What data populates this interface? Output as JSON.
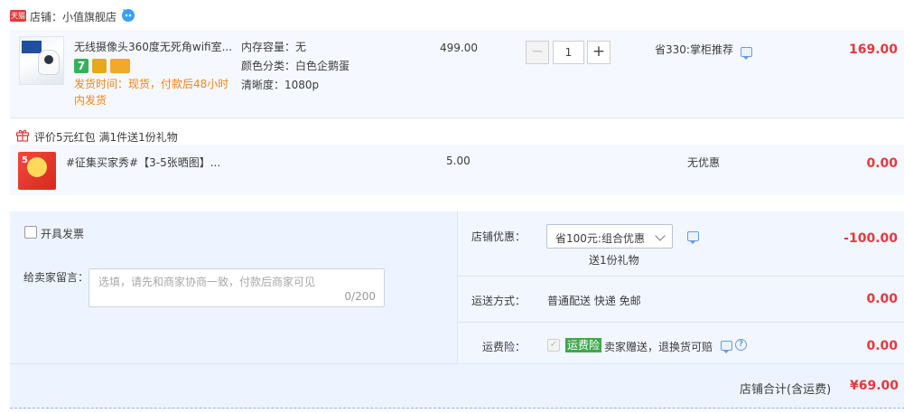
{
  "shop": {
    "badge": "天猫",
    "label": "店铺：小值旗舰店"
  },
  "items": [
    {
      "title": "无线摄像头360度无死角wifi室...",
      "delivery": "发货时间：现货，付款后48小时内发货",
      "service_badge": "7",
      "attrs": [
        "内存容量：无",
        "颜色分类：白色企鹅蛋",
        "清晰度：1080p"
      ],
      "price": "499.00",
      "quantity": "1",
      "promo": "省330:掌柜推荐",
      "amount": "169.00"
    },
    {
      "title": "#征集买家秀#【3-5张晒图】...",
      "thumb_text": "5",
      "price": "5.00",
      "promo": "无优惠",
      "amount": "0.00"
    }
  ],
  "gift_line": "评价5元红包   满1件送1份礼物",
  "qty_controls": {
    "minus": "−",
    "plus": "+"
  },
  "invoice": {
    "label": "开具发票"
  },
  "message": {
    "label": "给卖家留言：",
    "placeholder": "选填，请先和商家协商一致，付款后商家可见",
    "counter": "0/200"
  },
  "shop_discount": {
    "label": "店铺优惠：",
    "selected": "省100元:组合优惠",
    "gift": "送1份礼物",
    "amount": "-100.00"
  },
  "shipping": {
    "label": "运送方式：",
    "value": "普通配送 快递 免邮",
    "amount": "0.00"
  },
  "insurance": {
    "label": "运费险：",
    "badge": "运费险",
    "text": "卖家赠送，退换货可赔",
    "amount": "0.00"
  },
  "total": {
    "label": "店铺合计(含运费)",
    "amount": "¥69.00"
  },
  "colors": {
    "accent_red": "#e4393c",
    "delivery_orange": "#f08519",
    "insurance_green": "#3ea84a",
    "row_bg": "#f5f8ff"
  }
}
